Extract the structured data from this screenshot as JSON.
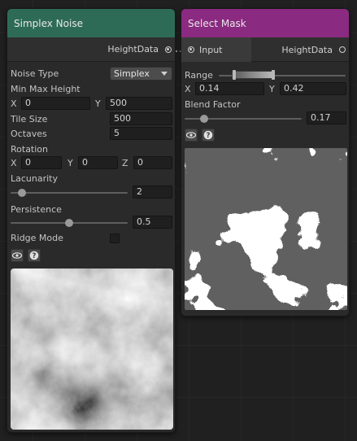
{
  "simplex_node": {
    "title": "Simplex Noise",
    "header_color": "#2e6b57",
    "output_port": "HeightData",
    "noise_type": {
      "label": "Noise Type",
      "value": "Simplex"
    },
    "min_max_height": {
      "label": "Min Max Height",
      "x_label": "X",
      "x": "0",
      "y_label": "Y",
      "y": "500"
    },
    "tile_size": {
      "label": "Tile Size",
      "value": "500"
    },
    "octaves": {
      "label": "Octaves",
      "value": "5"
    },
    "rotation": {
      "label": "Rotation",
      "x_label": "X",
      "x": "0",
      "y_label": "Y",
      "y": "0",
      "z_label": "Z",
      "z": "0"
    },
    "lacunarity": {
      "label": "Lacunarity",
      "value": "2",
      "slider_level": 0.1
    },
    "persistence": {
      "label": "Persistence",
      "value": "0.5",
      "slider_level": 0.5
    },
    "ridge_mode": {
      "label": "Ridge Mode",
      "checked": false
    },
    "preview_icon": "eye-icon",
    "help_icon": "help-icon"
  },
  "mask_node": {
    "title": "Select Mask",
    "header_color": "#8a2a80",
    "input_port": "Input",
    "output_port": "HeightData",
    "range": {
      "label": "Range",
      "x_label": "X",
      "x": "0.14",
      "y_label": "Y",
      "y": "0.42"
    },
    "blend_factor": {
      "label": "Blend Factor",
      "value": "0.17",
      "slider_level": 0.17
    },
    "preview_icon": "eye-icon",
    "help_icon": "help-icon"
  }
}
